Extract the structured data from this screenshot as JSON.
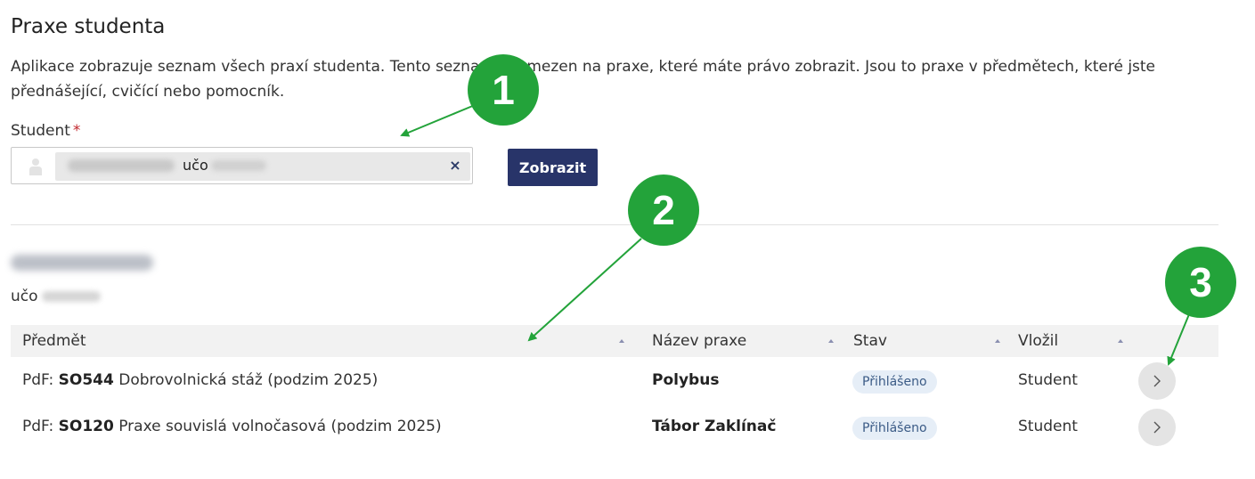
{
  "page": {
    "title": "Praxe studenta",
    "intro": "Aplikace zobrazuje seznam všech praxí studenta. Tento seznam je omezen na praxe, které máte právo zobrazit. Jsou to praxe v předmětech, které jste přednášející, cvičící nebo pomocník."
  },
  "form": {
    "student_label": "Student",
    "required_marker": "*",
    "selected_student": {
      "uco_label": "učo"
    },
    "remove_label": "×",
    "show_button": "Zobrazit"
  },
  "result": {
    "uco_label": "učo"
  },
  "table": {
    "headers": [
      "Předmět",
      "Název praxe",
      "Stav",
      "Vložil"
    ],
    "rows": [
      {
        "subject_prefix": "PdF:",
        "subject_code": "SO544",
        "subject_name": "Dobrovolnická stáž (podzim 2025)",
        "practice_name": "Polybus",
        "status": "Přihlášeno",
        "inserted_by": "Student"
      },
      {
        "subject_prefix": "PdF:",
        "subject_code": "SO120",
        "subject_name": "Praxe souvislá volnočasová (podzim 2025)",
        "practice_name": "Tábor Zaklínač",
        "status": "Přihlášeno",
        "inserted_by": "Student"
      }
    ]
  },
  "callouts": [
    "1",
    "2",
    "3"
  ],
  "colors": {
    "primary_button": "#283469",
    "callout": "#23a33a",
    "status_badge_bg": "#e6eef7",
    "required": "#c1272d"
  }
}
